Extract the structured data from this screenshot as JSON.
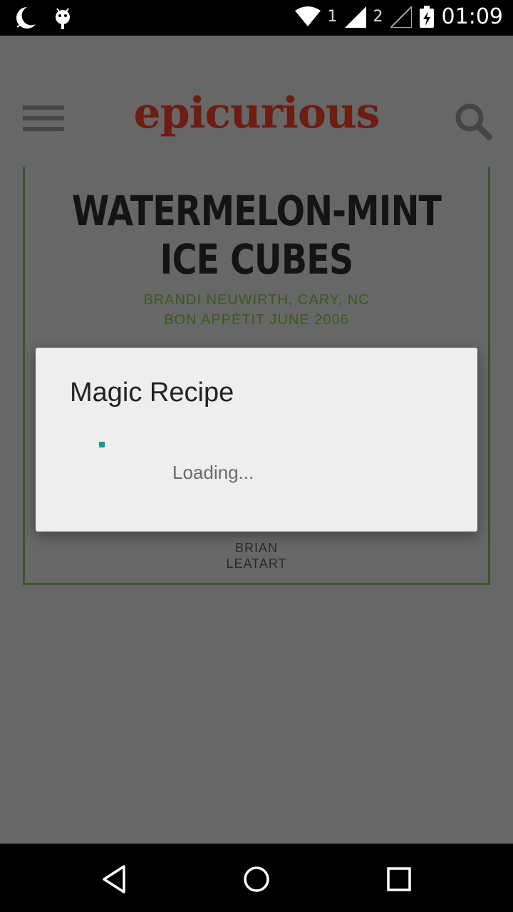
{
  "status_bar": {
    "sim1_label": "1",
    "sim2_label": "2",
    "time": "01:09",
    "icons": [
      "moon-icon",
      "android-debug-icon",
      "wifi-icon",
      "signal-icon",
      "battery-charging-icon"
    ]
  },
  "header": {
    "logo_text": "epicurious",
    "logo_color": "#6e1d12",
    "menu_icon": "hamburger-menu-icon",
    "search_icon": "search-icon"
  },
  "recipe": {
    "title_line1": "WATERMELON-MINT",
    "title_line2": "ICE CUBES",
    "byline_author": "BRANDI NEUWIRTH, CARY, NC",
    "byline_source": "BON APPÉTIT JUNE 2006",
    "credit_line1": "BRIAN",
    "credit_line2": "LEATART",
    "accent_color": "#3b5a1c"
  },
  "dialog": {
    "title": "Magic Recipe",
    "message": "Loading...",
    "spinner_color": "#139b94"
  },
  "nav_bar": {
    "icons": [
      "back-icon",
      "home-icon",
      "recents-icon"
    ]
  }
}
